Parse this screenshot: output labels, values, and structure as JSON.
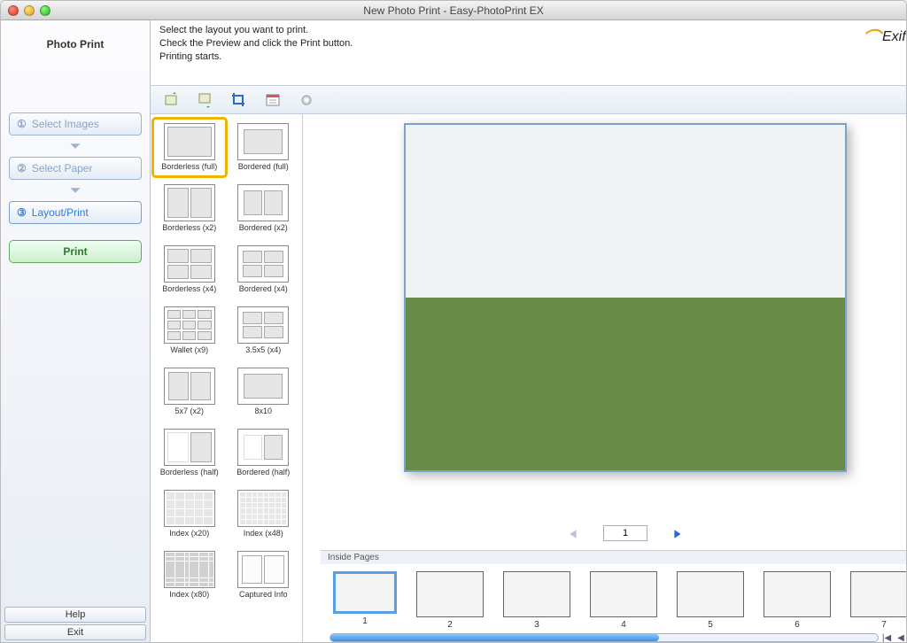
{
  "window_title": "New Photo Print - Easy-PhotoPrint EX",
  "sidebar": {
    "heading": "Photo Print",
    "steps": [
      {
        "num": "①",
        "label": "Select Images"
      },
      {
        "num": "②",
        "label": "Select Paper"
      },
      {
        "num": "③",
        "label": "Layout/Print"
      }
    ],
    "print_label": "Print",
    "help_label": "Help",
    "exit_label": "Exit"
  },
  "info": {
    "line1": "Select the layout you want to print.",
    "line2": "Check the Preview and click the Print button.",
    "line3": "Printing starts."
  },
  "brand": {
    "name": "Exif Print"
  },
  "layouts": [
    {
      "id": "borderless-full",
      "label": "Borderless (full)",
      "selected": true
    },
    {
      "id": "bordered-full",
      "label": "Bordered (full)"
    },
    {
      "id": "borderless-x2",
      "label": "Borderless (x2)"
    },
    {
      "id": "bordered-x2",
      "label": "Bordered (x2)"
    },
    {
      "id": "borderless-x4",
      "label": "Borderless (x4)"
    },
    {
      "id": "bordered-x4",
      "label": "Bordered (x4)"
    },
    {
      "id": "wallet-x9",
      "label": "Wallet (x9)"
    },
    {
      "id": "35x5-x4",
      "label": "3.5x5 (x4)"
    },
    {
      "id": "5x7-x2",
      "label": "5x7 (x2)"
    },
    {
      "id": "8x10",
      "label": "8x10"
    },
    {
      "id": "borderless-half",
      "label": "Borderless (half)"
    },
    {
      "id": "bordered-half",
      "label": "Bordered (half)"
    },
    {
      "id": "index-x20",
      "label": "Index (x20)"
    },
    {
      "id": "index-x48",
      "label": "Index (x48)"
    },
    {
      "id": "index-x80",
      "label": "Index (x80)"
    },
    {
      "id": "captured-info",
      "label": "Captured Info"
    }
  ],
  "pager": {
    "current": "1"
  },
  "inside_header": "Inside Pages",
  "thumbs": [
    {
      "label": "1",
      "selected": true,
      "kind": "house"
    },
    {
      "label": "2",
      "kind": "wfall"
    },
    {
      "label": "3",
      "kind": "pano"
    },
    {
      "label": "4",
      "kind": "crowd"
    },
    {
      "label": "5",
      "kind": "glacier"
    },
    {
      "label": "6",
      "kind": "rock"
    },
    {
      "label": "7",
      "kind": "hikers"
    }
  ]
}
